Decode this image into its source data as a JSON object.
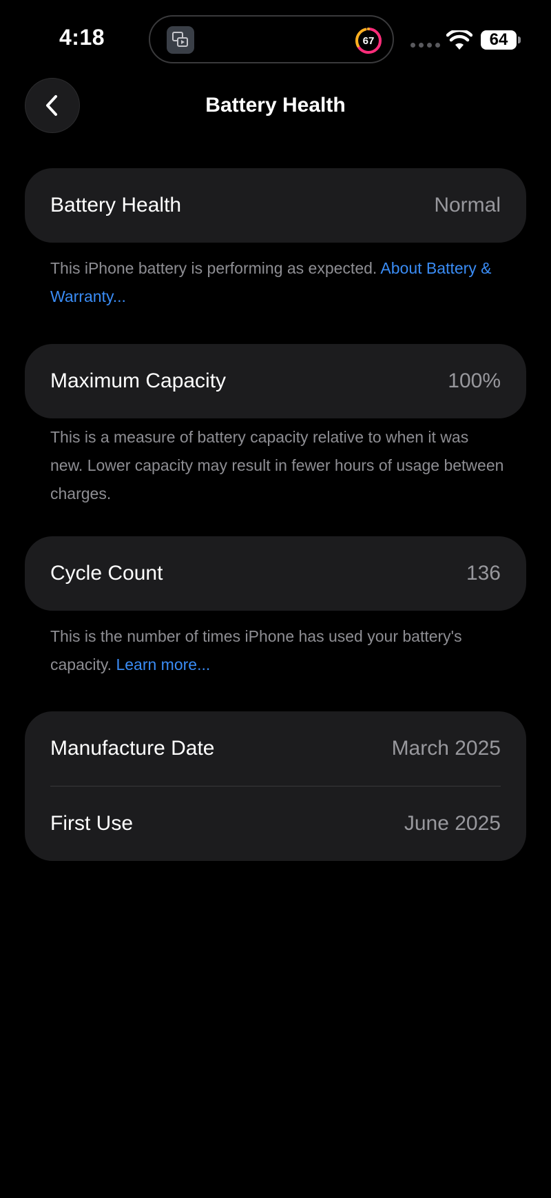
{
  "status_bar": {
    "time": "4:18",
    "activity_ring_value": "67",
    "battery_level": "64"
  },
  "icons": {
    "island_app": "screen-mirroring-icon",
    "wifi": "wifi-icon",
    "back": "chevron-left-icon"
  },
  "colors": {
    "background": "#000000",
    "card": "#1c1c1e",
    "link": "#3a8cf5",
    "secondary_text": "#8e8e93"
  },
  "nav": {
    "title": "Battery Health"
  },
  "sections": {
    "health": {
      "label": "Battery Health",
      "value": "Normal",
      "footnote_text": "This iPhone battery is performing as expected. ",
      "footnote_link": "About Battery & Warranty..."
    },
    "capacity": {
      "label": "Maximum Capacity",
      "value": "100%",
      "footnote_text": "This is a measure of battery capacity relative to when it was new. Lower capacity may result in fewer hours of usage between charges."
    },
    "cycle": {
      "label": "Cycle Count",
      "value": "136",
      "footnote_text": "This is the number of times iPhone has used your battery's capacity. ",
      "footnote_link": "Learn more..."
    },
    "dates": {
      "manufacture_label": "Manufacture Date",
      "manufacture_value": "March 2025",
      "first_use_label": "First Use",
      "first_use_value": "June 2025"
    }
  }
}
